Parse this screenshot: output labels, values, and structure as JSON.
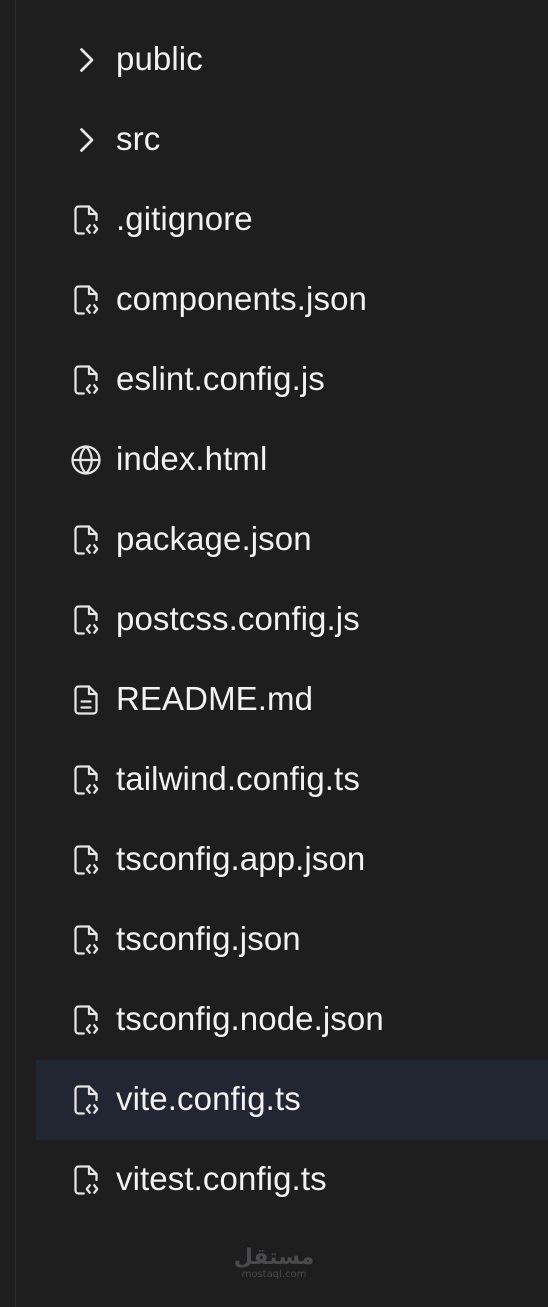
{
  "explorer": {
    "items": [
      {
        "label": "public",
        "icon": "chevron-right-icon",
        "kind": "folder",
        "selected": false
      },
      {
        "label": "src",
        "icon": "chevron-right-icon",
        "kind": "folder",
        "selected": false
      },
      {
        "label": ".gitignore",
        "icon": "file-code-icon",
        "kind": "file",
        "selected": false
      },
      {
        "label": "components.json",
        "icon": "file-code-icon",
        "kind": "file",
        "selected": false
      },
      {
        "label": "eslint.config.js",
        "icon": "file-code-icon",
        "kind": "file",
        "selected": false
      },
      {
        "label": "index.html",
        "icon": "globe-icon",
        "kind": "file",
        "selected": false
      },
      {
        "label": "package.json",
        "icon": "file-code-icon",
        "kind": "file",
        "selected": false
      },
      {
        "label": "postcss.config.js",
        "icon": "file-code-icon",
        "kind": "file",
        "selected": false
      },
      {
        "label": "README.md",
        "icon": "file-text-icon",
        "kind": "file",
        "selected": false
      },
      {
        "label": "tailwind.config.ts",
        "icon": "file-code-icon",
        "kind": "file",
        "selected": false
      },
      {
        "label": "tsconfig.app.json",
        "icon": "file-code-icon",
        "kind": "file",
        "selected": false
      },
      {
        "label": "tsconfig.json",
        "icon": "file-code-icon",
        "kind": "file",
        "selected": false
      },
      {
        "label": "tsconfig.node.json",
        "icon": "file-code-icon",
        "kind": "file",
        "selected": false
      },
      {
        "label": "vite.config.ts",
        "icon": "file-code-icon",
        "kind": "file",
        "selected": true
      },
      {
        "label": "vitest.config.ts",
        "icon": "file-code-icon",
        "kind": "file",
        "selected": false
      }
    ]
  },
  "watermark": {
    "arabic": "مستقل",
    "latin": "mostaql.com"
  },
  "colors": {
    "background": "#1e1e1f",
    "selected_row": "#222632",
    "text": "#f2f2f2",
    "icon": "#e6e6e6",
    "watermark": "#4a4a4c"
  }
}
